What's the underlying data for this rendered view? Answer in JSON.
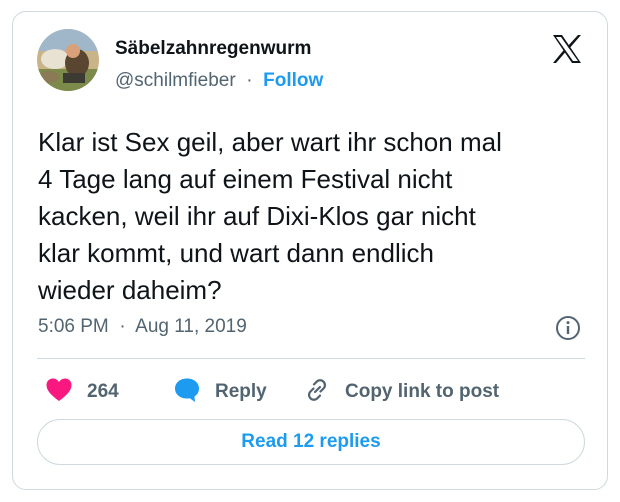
{
  "author": {
    "display_name": "Säbelzahnregenwurm",
    "handle": "@schilmfieber",
    "separator": "·",
    "follow_label": "Follow"
  },
  "tweet": {
    "text_lines": [
      "Klar ist Sex geil, aber wart ihr schon mal",
      "4 Tage lang auf einem Festival nicht",
      "kacken, weil ihr auf Dixi-Klos gar nicht",
      "klar kommt, und wart dann endlich",
      "wieder daheim?"
    ],
    "time": "5:06 PM",
    "separator": "·",
    "date": "Aug 11, 2019"
  },
  "actions": {
    "like_count": "264",
    "reply_label": "Reply",
    "copy_link_label": "Copy link to post"
  },
  "read_replies_label": "Read 12 replies",
  "icons": {
    "logo": "x-logo-icon",
    "info": "info-icon",
    "like": "heart-icon",
    "reply": "speech-bubble-icon",
    "link": "link-icon"
  },
  "colors": {
    "accent": "#1d9bf0",
    "like": "#f91880",
    "secondary_text": "#536471",
    "border": "#cfd9de",
    "text": "#0f1419"
  }
}
